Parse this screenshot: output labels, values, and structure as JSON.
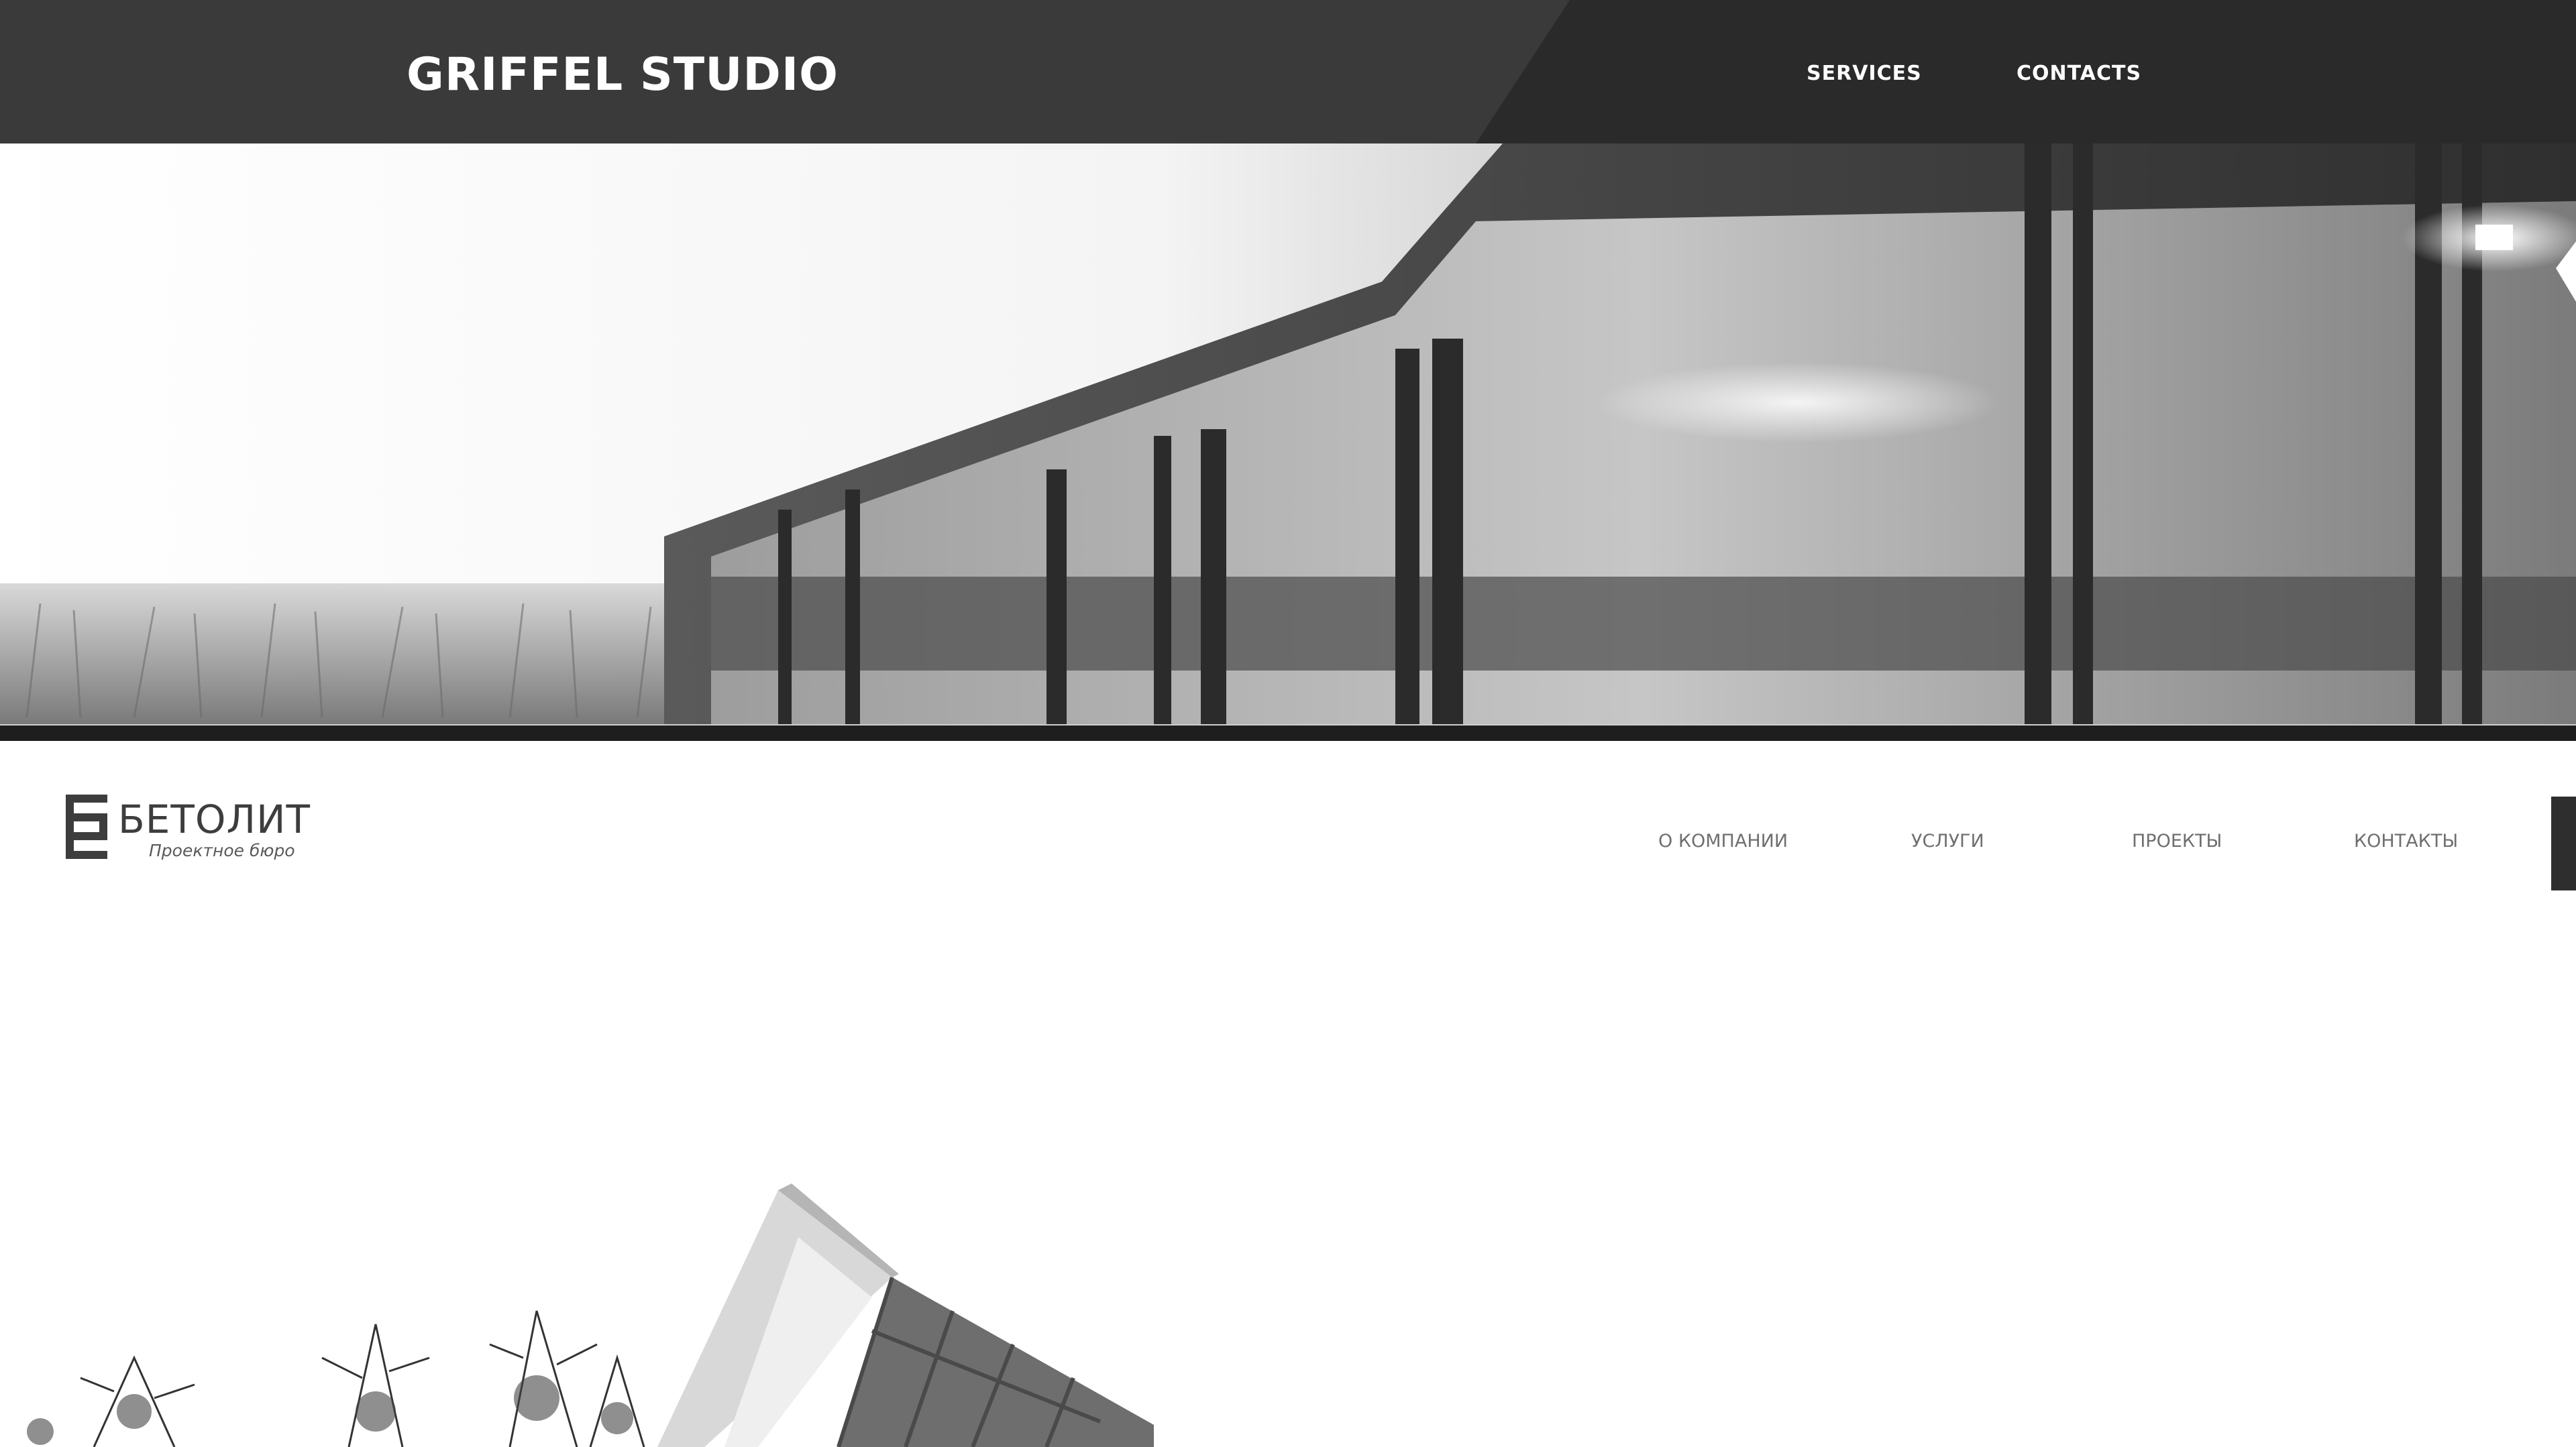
{
  "site1": {
    "logo": "GRIFFEL STUDIO",
    "nav": {
      "services": "SERVICES",
      "contacts": "CONTACTS"
    }
  },
  "site2": {
    "brand": "БЕТОЛИТ",
    "tagline": "Проектное бюро",
    "nav": {
      "company": "О КОМПАНИИ",
      "services": "УСЛУГИ",
      "projects": "ПРОЕКТЫ",
      "contacts": "КОНТАКТЫ"
    }
  },
  "colors": {
    "header_bg": "#3a3a3a",
    "header_dark": "#2a2a2a",
    "nav_text_light": "#ffffff",
    "nav_text_gray": "#6f6f6f",
    "brand_text": "#3d3d3d"
  }
}
